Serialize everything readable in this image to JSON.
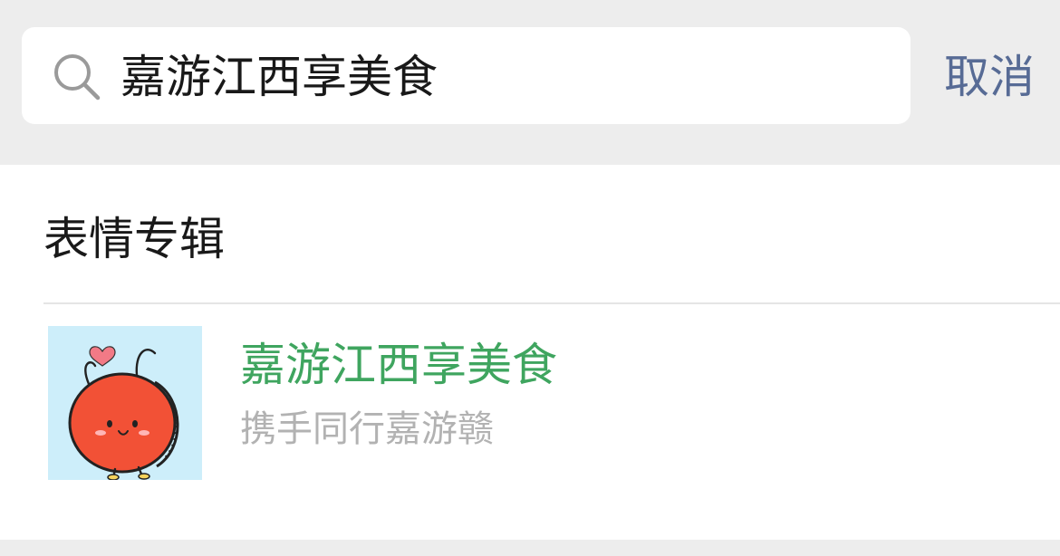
{
  "search": {
    "query": "嘉游江西享美食",
    "cancel_label": "取消",
    "icon": "search-icon"
  },
  "results": {
    "section_title": "表情专辑",
    "items": [
      {
        "title": "嘉游江西享美食",
        "subtitle": "携手同行嘉游赣",
        "thumbnail": "red-mascot-sticker"
      }
    ]
  },
  "colors": {
    "background": "#ededed",
    "surface": "#ffffff",
    "link": "#576b95",
    "highlight": "#3fa55f",
    "muted": "#b2b2b2",
    "text": "#191919"
  }
}
